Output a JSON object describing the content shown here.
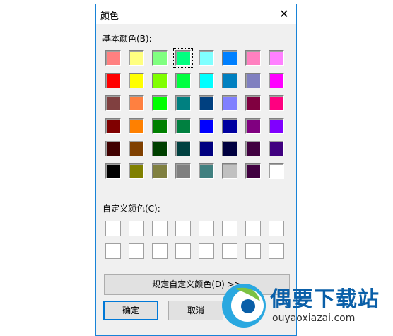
{
  "dialog": {
    "title": "颜色",
    "close_label": "✕",
    "basic_label": "基本颜色(B):",
    "custom_label": "自定义颜色(C):",
    "define_custom_button": "规定自定义颜色(D) >>",
    "ok_button": "确定",
    "cancel_button": "取消"
  },
  "basic_colors": [
    [
      "#ff8080",
      "#ffff80",
      "#80ff80",
      "#00ff80",
      "#80ffff",
      "#0080ff",
      "#ff80c0",
      "#ff80ff"
    ],
    [
      "#ff0000",
      "#ffff00",
      "#80ff00",
      "#00ff40",
      "#00ffff",
      "#0080c0",
      "#8080c0",
      "#ff00ff"
    ],
    [
      "#804040",
      "#ff8040",
      "#00ff00",
      "#008080",
      "#004080",
      "#8080ff",
      "#800040",
      "#ff0080"
    ],
    [
      "#800000",
      "#ff8000",
      "#008000",
      "#008040",
      "#0000ff",
      "#0000a0",
      "#800080",
      "#8000ff"
    ],
    [
      "#400000",
      "#804000",
      "#004000",
      "#004040",
      "#000080",
      "#000040",
      "#400040",
      "#400080"
    ],
    [
      "#000000",
      "#808000",
      "#808040",
      "#808080",
      "#408080",
      "#c0c0c0",
      "#400040",
      "#ffffff"
    ]
  ],
  "selected_color": {
    "row": 0,
    "col": 3
  },
  "custom_colors": [
    [
      "#ffffff",
      "#ffffff",
      "#ffffff",
      "#ffffff",
      "#ffffff",
      "#ffffff",
      "#ffffff",
      "#ffffff"
    ],
    [
      "#ffffff",
      "#ffffff",
      "#ffffff",
      "#ffffff",
      "#ffffff",
      "#ffffff",
      "#ffffff",
      "#ffffff"
    ]
  ],
  "watermark": {
    "name": "偶要下载站",
    "url": "ouyaoxiazai.com"
  }
}
